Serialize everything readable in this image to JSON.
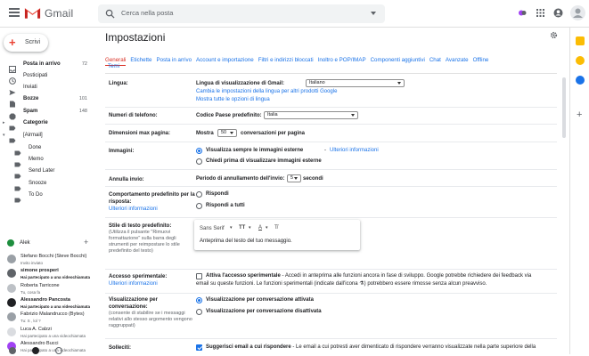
{
  "app": {
    "name": "Gmail"
  },
  "search": {
    "placeholder": "Cerca nella posta"
  },
  "compose": {
    "label": "Scrivi"
  },
  "nav": [
    {
      "label": "Posta in arrivo",
      "count": "72",
      "icon": "inbox-icon",
      "bold": true
    },
    {
      "label": "Posticipati",
      "count": "",
      "icon": "clock-icon",
      "bold": false
    },
    {
      "label": "Inviati",
      "count": "",
      "icon": "send-icon",
      "bold": false
    },
    {
      "label": "Bozze",
      "count": "101",
      "icon": "draft-icon",
      "bold": true
    },
    {
      "label": "Spam",
      "count": "148",
      "icon": "spam-icon",
      "bold": true
    },
    {
      "label": "Categorie",
      "count": "",
      "icon": "label-icon",
      "bold": true
    },
    {
      "label": "[Airmail]",
      "count": "",
      "icon": "label-icon",
      "bold": false
    },
    {
      "label": "Done",
      "count": "",
      "icon": "label-icon",
      "bold": false
    },
    {
      "label": "Memo",
      "count": "",
      "icon": "label-icon",
      "bold": false
    },
    {
      "label": "Send Later",
      "count": "",
      "icon": "label-icon",
      "bold": false
    },
    {
      "label": "Snooze",
      "count": "",
      "icon": "label-icon",
      "bold": false
    },
    {
      "label": "To Do",
      "count": "",
      "icon": "label-icon",
      "bold": false
    }
  ],
  "chat": {
    "me": "Alek",
    "contacts": [
      {
        "name": "Stefano Bocchi (Steve Bocchi)",
        "status": "Invito inviato",
        "bold": false
      },
      {
        "name": "simone prosperi",
        "status": "Hai partecipato a una videochiamata",
        "bold": true
      },
      {
        "name": "Roberta Tarricone",
        "status": "Tu, cosa fa",
        "bold": false
      },
      {
        "name": "Alessandro Pancosta",
        "status": "Hai partecipato a una videochiamata",
        "bold": true
      },
      {
        "name": "Fabrizio Malandrucco (Bytes)",
        "status": "Tu: S , lol ?",
        "bold": false
      },
      {
        "name": "Luca A. Calzzi",
        "status": "Hai partecipato a una videochiamata",
        "bold": false
      },
      {
        "name": "Alessandro Bucci",
        "status": "Hai partecipato a una videochiamata",
        "bold": false
      }
    ]
  },
  "settings": {
    "title": "Impostazioni",
    "tabs": [
      "Generali",
      "Etichette",
      "Posta in arrivo",
      "Account e importazione",
      "Filtri e indirizzi bloccati",
      "Inoltro e POP/IMAP",
      "Componenti aggiuntivi",
      "Chat",
      "Avanzate",
      "Offline"
    ],
    "tab_second_line": "Temi",
    "language": {
      "label": "Lingua:",
      "display_label": "Lingua di visualizzazione di Gmail:",
      "value": "Italiano",
      "link1": "Cambia le impostazioni della lingua per altri prodotti Google",
      "link2": "Mostra tutte le opzioni di lingua"
    },
    "phone": {
      "label": "Numeri di telefono:",
      "code_label": "Codice Paese predefinito:",
      "value": "Italia"
    },
    "pagesize": {
      "label": "Dimensioni max pagina:",
      "show": "Mostra",
      "value": "50",
      "suffix": "conversazioni per pagina"
    },
    "images": {
      "label": "Immagini:",
      "opt1": "Visualizza sempre le immagini esterne",
      "opt1_link": "Ulteriori informazioni",
      "opt2": "Chiedi prima di visualizzare immagini esterne"
    },
    "undo": {
      "label": "Annulla invio:",
      "text": "Periodo di annullamento dell'invio:",
      "value": "5",
      "suffix": "secondi"
    },
    "reply": {
      "label1": "Comportamento predefinito per la",
      "label2": "risposta:",
      "link": "Ulteriori informazioni",
      "opt1": "Rispondi",
      "opt2": "Rispondi a tutti"
    },
    "textstyle": {
      "label": "Stile di testo predefinito:",
      "note1": "(Utilizza il pulsante \"Rimuovi",
      "note2": "formattazione\" sulla barra degli",
      "note3": "strumenti per reimpostare lo stile",
      "note4": "predefinito del testo)",
      "font": "Sans Serif",
      "preview": "Anteprima del testo del tuo messaggio."
    },
    "experimental": {
      "label": "Accesso sperimentale:",
      "link": "Ulteriori informazioni",
      "title": "Attiva l'accesso sperimentale",
      "text1": " - Accedi in anteprima alle funzioni ancora in fase di sviluppo. Google potrebbe richiedere dei feedback via",
      "text2": "email su queste funzioni. Le funzioni sperimentali (indicate dall'icona",
      "text3": ") potrebbero essere rimosse senza alcun preavviso."
    },
    "conversation": {
      "label1": "Visualizzazione per",
      "label2": "conversazione:",
      "note1": "(consente di stabilire se i messaggi",
      "note2": "relativi allo stesso argomento vengono",
      "note3": "raggruppati)",
      "opt1": "Visualizzazione per conversazione attivata",
      "opt2": "Visualizzazione per conversazione disattivata"
    },
    "nudges": {
      "label": "Solleciti:",
      "title": "Suggerisci email a cui rispondere",
      "text": " - Le email a cui potresti aver dimenticato di rispondere verranno visualizzate nella parte superiore della"
    }
  },
  "colors": {
    "accent": "#1a73e8",
    "red": "#d93025"
  }
}
